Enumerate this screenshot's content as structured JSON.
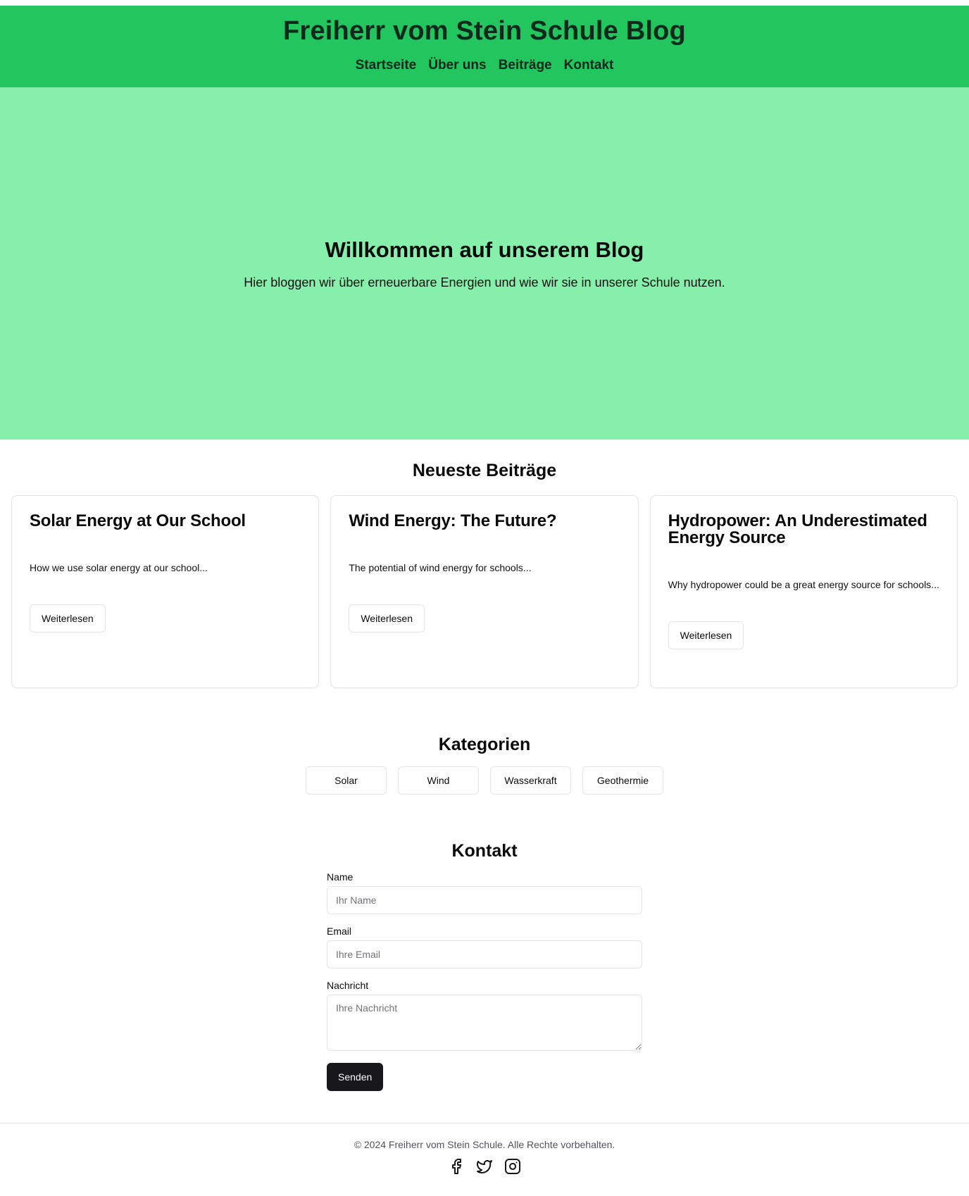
{
  "header": {
    "title": "Freiherr vom Stein Schule Blog",
    "nav": [
      "Startseite",
      "Über uns",
      "Beiträge",
      "Kontakt"
    ]
  },
  "hero": {
    "title": "Willkommen auf unserem Blog",
    "subtitle": "Hier bloggen wir über erneuerbare Energien und wie wir sie in unserer Schule nutzen."
  },
  "posts": {
    "title": "Neueste Beiträge",
    "items": [
      {
        "title": "Solar Energy at Our School",
        "excerpt": "How we use solar energy at our school...",
        "button": "Weiterlesen"
      },
      {
        "title": "Wind Energy: The Future?",
        "excerpt": "The potential of wind energy for schools...",
        "button": "Weiterlesen"
      },
      {
        "title": "Hydropower: An Underestimated Energy Source",
        "excerpt": "Why hydropower could be a great energy source for schools...",
        "button": "Weiterlesen"
      }
    ]
  },
  "categories": {
    "title": "Kategorien",
    "items": [
      "Solar",
      "Wind",
      "Wasserkraft",
      "Geothermie"
    ]
  },
  "contact": {
    "title": "Kontakt",
    "name_label": "Name",
    "name_placeholder": "Ihr Name",
    "email_label": "Email",
    "email_placeholder": "Ihre Email",
    "message_label": "Nachricht",
    "message_placeholder": "Ihre Nachricht",
    "submit": "Senden"
  },
  "footer": {
    "copyright": "© 2024 Freiherr vom Stein Schule. Alle Rechte vorbehalten.",
    "social_icons": [
      "facebook-icon",
      "twitter-icon",
      "instagram-icon"
    ]
  },
  "colors": {
    "header_bg": "#22c55e",
    "hero_bg": "#86efac",
    "primary_button": "#18181b"
  }
}
